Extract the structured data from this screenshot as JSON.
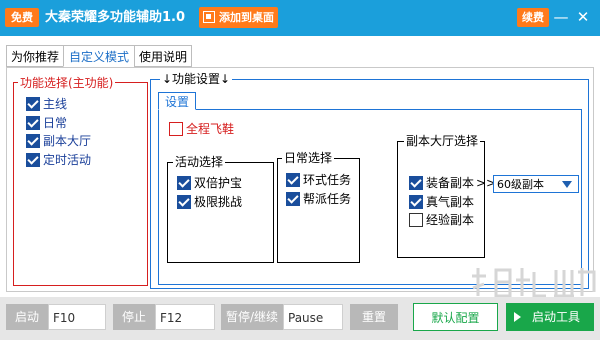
{
  "title_bar": {
    "free_badge": "免费",
    "title": "大秦荣耀多功能辅助1.0",
    "add_to_desktop": "添加到桌面",
    "renew": "续费",
    "minimize": "—",
    "close": "✕",
    "bg_color": "#1b9fdb",
    "accent_color": "#ff7a1a"
  },
  "tabs": [
    {
      "label": "为你推荐",
      "active": false
    },
    {
      "label": "自定义模式",
      "active": true
    },
    {
      "label": "使用说明",
      "active": false
    }
  ],
  "function_select": {
    "title": "功能选择(主功能)",
    "items": [
      {
        "label": "主线",
        "checked": true
      },
      {
        "label": "日常",
        "checked": true
      },
      {
        "label": "副本大厅",
        "checked": true
      },
      {
        "label": "定时活动",
        "checked": true
      }
    ]
  },
  "function_settings": {
    "title": "↓功能设置↓",
    "inner_tab": "设置",
    "full_fly": {
      "label": "全程飞鞋",
      "checked": false
    },
    "activity": {
      "title": "活动选择",
      "items": [
        {
          "label": "双倍护宝",
          "checked": true
        },
        {
          "label": "极限挑战",
          "checked": true
        }
      ]
    },
    "daily": {
      "title": "日常选择",
      "items": [
        {
          "label": "环式任务",
          "checked": true
        },
        {
          "label": "帮派任务",
          "checked": true
        }
      ]
    },
    "dungeon": {
      "title": "副本大厅选择",
      "items": [
        {
          "label": "装备副本",
          "checked": true
        },
        {
          "label": "真气副本",
          "checked": true
        },
        {
          "label": "经验副本",
          "checked": false
        }
      ],
      "arrow": ">>",
      "select_value": "60级副本"
    }
  },
  "bottom_bar": {
    "start_label": "启动",
    "start_key": "F10",
    "stop_label": "停止",
    "stop_key": "F12",
    "pause_label": "暂停/继续",
    "pause_key": "Pause",
    "reset": "重置",
    "default_config": "默认配置",
    "launch_tool": "启动工具",
    "green_color": "#19a74a"
  }
}
